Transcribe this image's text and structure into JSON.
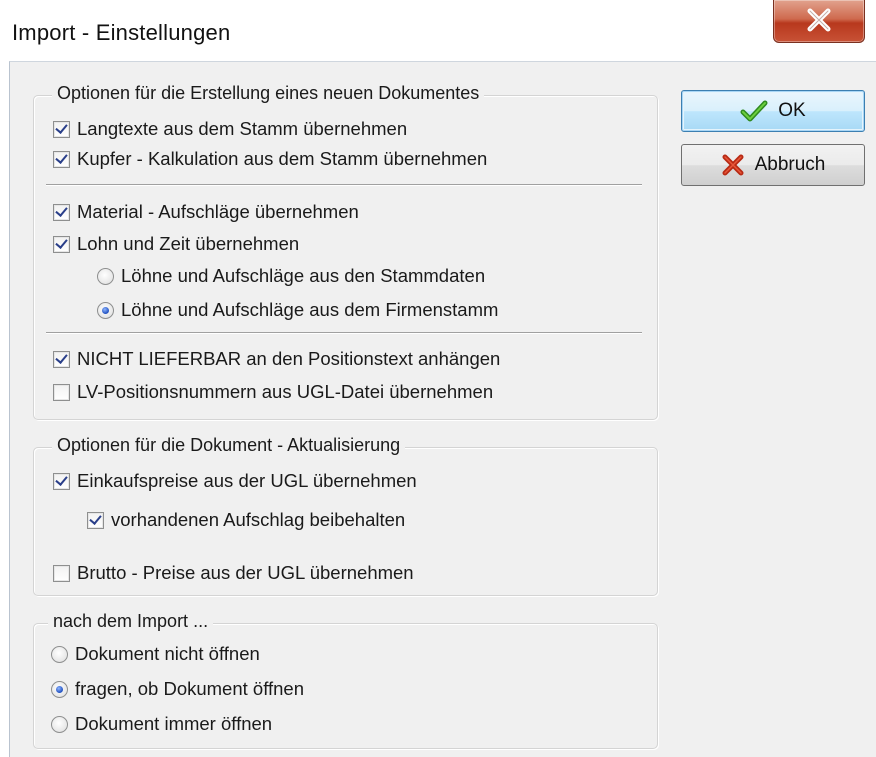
{
  "window": {
    "title": "Import - Einstellungen",
    "close_icon": "close-icon"
  },
  "buttons": {
    "ok_label": "OK",
    "ok_icon": "checkmark-icon",
    "cancel_label": "Abbruch",
    "cancel_icon": "cross-icon"
  },
  "group_new_document": {
    "title": "Optionen für die Erstellung eines neuen Dokumentes",
    "langtexte": {
      "label": "Langtexte aus dem Stamm übernehmen",
      "checked": true
    },
    "kupfer": {
      "label": "Kupfer - Kalkulation aus dem Stamm übernehmen",
      "checked": true
    },
    "material": {
      "label": "Material - Aufschläge übernehmen",
      "checked": true
    },
    "lohn_zeit": {
      "label": "Lohn und Zeit übernehmen",
      "checked": true
    },
    "loehne_stammdaten": {
      "label": "Löhne und Aufschläge aus den Stammdaten",
      "selected": false
    },
    "loehne_firmenstamm": {
      "label": "Löhne und Aufschläge aus dem Firmenstamm",
      "selected": true
    },
    "nicht_lieferbar": {
      "label": "NICHT LIEFERBAR an den Positionstext anhängen",
      "checked": true
    },
    "lv_positionsnummern": {
      "label": "LV-Positionsnummern aus UGL-Datei übernehmen",
      "checked": false
    }
  },
  "group_update": {
    "title": "Optionen für die Dokument - Aktualisierung",
    "einkaufspreise": {
      "label": "Einkaufspreise aus der UGL übernehmen",
      "checked": true
    },
    "aufschlag_beibehalten": {
      "label": "vorhandenen Aufschlag beibehalten",
      "checked": true
    },
    "brutto_preise": {
      "label": "Brutto - Preise aus der UGL übernehmen",
      "checked": false
    }
  },
  "group_after_import": {
    "title": "nach dem Import ...",
    "nicht_oeffnen": {
      "label": "Dokument nicht öffnen",
      "selected": false
    },
    "fragen": {
      "label": "fragen, ob Dokument öffnen",
      "selected": true
    },
    "immer_oeffnen": {
      "label": "Dokument immer öffnen",
      "selected": false
    }
  },
  "colors": {
    "close_button": "#c85236",
    "ok_check": "#3c9a2a",
    "cancel_cross": "#c9331b",
    "dialog_background": "#f0f0f0"
  }
}
